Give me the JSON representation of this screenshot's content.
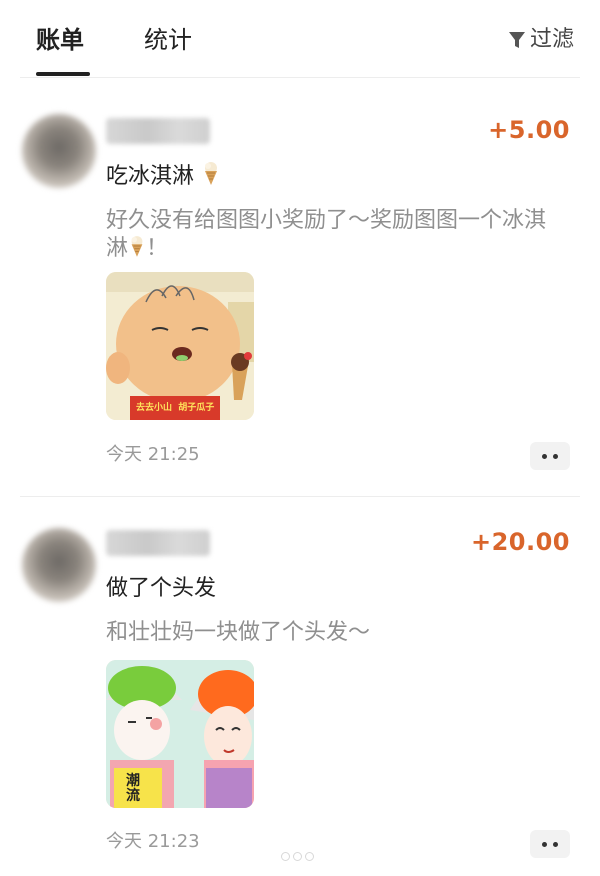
{
  "tabs": [
    {
      "label": "账单",
      "active": true
    },
    {
      "label": "统计",
      "active": false
    }
  ],
  "filter": {
    "label": "过滤",
    "icon": "filter-icon"
  },
  "entries": [
    {
      "amount": "+5.00",
      "title": "吃冰淇淋",
      "description": "好久没有给图图小奖励了～奖励图图一个冰淇淋",
      "description_suffix": "！",
      "emoji": "ice-cream-icon",
      "photo_caption": "去去小山  胡子瓜子",
      "time": "今天 21:25"
    },
    {
      "amount": "+20.00",
      "title": "做了个头发",
      "description": "和壮壮妈一块做了个头发～",
      "photo_caption": "潮流",
      "time": "今天 21:23"
    }
  ],
  "colors": {
    "amount": "#d9652b",
    "accent_text": "#222222",
    "muted_text": "#8f8f8f"
  }
}
